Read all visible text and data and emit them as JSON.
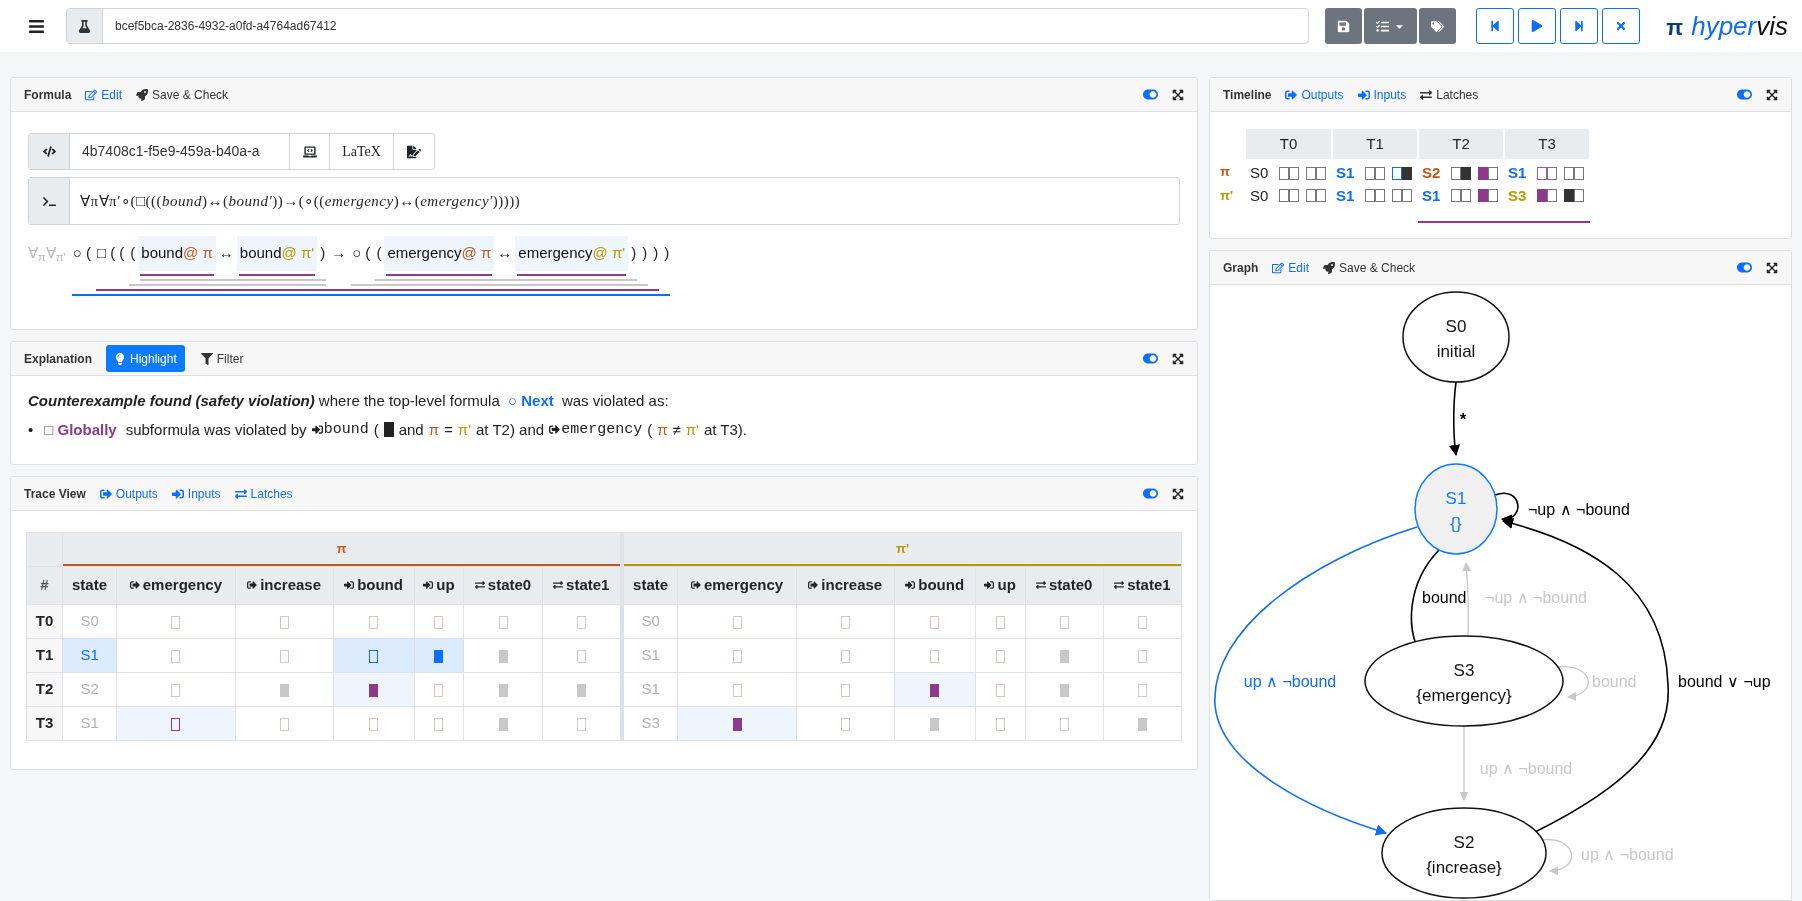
{
  "toolbar": {
    "session_id": "bcef5bca-2836-4932-a0fd-a4764ad67412",
    "file_buttons": [
      {
        "kind": "save"
      },
      {
        "kind": "checklist_menu"
      },
      {
        "kind": "tags"
      }
    ],
    "playback_buttons": [
      {
        "kind": "step_back"
      },
      {
        "kind": "play"
      },
      {
        "kind": "step_forward"
      },
      {
        "kind": "stop"
      }
    ],
    "logo": {
      "glyph": "π",
      "word_parts": [
        "hyper",
        "vis"
      ]
    }
  },
  "formula_panel": {
    "title": "Formula",
    "toggle_on": true,
    "actions": [
      {
        "kind": "edit",
        "label": "Edit"
      },
      {
        "kind": "run",
        "label": "Save & Check"
      }
    ],
    "formula_id": "4b7408c1-f5e9-459a-b40a-a",
    "id_buttons": [
      {
        "kind": "laptop"
      },
      {
        "kind": "latex",
        "label": "LaTeX"
      },
      {
        "kind": "sign"
      }
    ],
    "source": "∀π∀π′∘(□(((*bound*)↔(*bound′*))→(∘((*emergency*)↔(*emergency′*)))))",
    "quantifiers": "∀$_{π}$∀$_{π'}$",
    "tree": {
      "kind": "group",
      "color": "#0d6efd",
      "children": [
        {
          "kind": "text",
          "text": "○ ("
        },
        {
          "kind": "group",
          "color": "#8e3a8c",
          "children": [
            {
              "kind": "text",
              "text": "□ ( ("
            },
            {
              "kind": "group",
              "color": "#c8c8c8",
              "children": [
                {
                  "kind": "text",
                  "text": "("
                },
                {
                  "kind": "group",
                  "color": "#c8c8c8",
                  "children": [
                    {
                      "kind": "group",
                      "color": "#8e3a8c",
                      "children": [
                        {
                          "kind": "atom",
                          "name": "bound",
                          "marker": "@",
                          "trace": "π",
                          "color": "#c05a1a",
                          "highlighted": true
                        }
                      ]
                    },
                    {
                      "kind": "text",
                      "text": "↔"
                    },
                    {
                      "kind": "group",
                      "color": "#8e3a8c",
                      "children": [
                        {
                          "kind": "atom",
                          "name": "bound",
                          "marker": "@",
                          "trace": "π'",
                          "color": "#b89a00",
                          "highlighted": true
                        }
                      ]
                    },
                    {
                      "kind": "text",
                      "text": ")"
                    }
                  ]
                }
              ]
            },
            {
              "kind": "text",
              "text": "→"
            },
            {
              "kind": "group",
              "color": "#c8c8c8",
              "children": [
                {
                  "kind": "text",
                  "text": "○ ("
                },
                {
                  "kind": "group",
                  "color": "#c8c8c8",
                  "children": [
                    {
                      "kind": "text",
                      "text": "("
                    },
                    {
                      "kind": "group",
                      "color": "#8e3a8c",
                      "children": [
                        {
                          "kind": "atom",
                          "name": "emergency",
                          "marker": "@",
                          "trace": "π",
                          "color": "#c05a1a",
                          "highlighted": true
                        }
                      ]
                    },
                    {
                      "kind": "text",
                      "text": "↔"
                    },
                    {
                      "kind": "group",
                      "color": "#8e3a8c",
                      "children": [
                        {
                          "kind": "atom",
                          "name": "emergency",
                          "marker": "@",
                          "trace": "π'",
                          "color": "#b89a00",
                          "highlighted": true
                        }
                      ]
                    },
                    {
                      "kind": "text",
                      "text": ")"
                    }
                  ]
                },
                {
                  "kind": "text",
                  "text": ")"
                }
              ]
            },
            {
              "kind": "text",
              "text": ")"
            }
          ]
        },
        {
          "kind": "text",
          "text": ")"
        }
      ]
    }
  },
  "explanation_panel": {
    "title": "Explanation",
    "toggle_on": true,
    "tabs": [
      {
        "kind": "highlight",
        "label": "Highlight",
        "selected": true
      },
      {
        "kind": "filter",
        "label": "Filter",
        "selected": false
      }
    ],
    "summary": {
      "lead": "Counterexample found (safety violation)",
      "middle": " where the top-level formula ",
      "operator": {
        "symbol": "○",
        "name": "Next",
        "color": "#0d6efd"
      },
      "tail": " was violated as:"
    },
    "bullets": [
      {
        "marker": "•",
        "segments": [
          {
            "kind": "operator",
            "symbol": "□",
            "name": "Globally",
            "color": "#8e3a8c"
          },
          {
            "kind": "text",
            "text": "subformula was violated by"
          },
          {
            "kind": "input_signal",
            "name": "bound"
          },
          {
            "kind": "text",
            "text": "("
          },
          {
            "kind": "value",
            "value": true,
            "color": "#222222"
          },
          {
            "kind": "text",
            "text": "and"
          },
          {
            "kind": "trace",
            "text": "π",
            "color": "#c05a1a"
          },
          {
            "kind": "text",
            "text": "="
          },
          {
            "kind": "trace",
            "text": "π'",
            "color": "#b89a00"
          },
          {
            "kind": "text",
            "text": "at T2) and"
          },
          {
            "kind": "output_signal",
            "name": "emergency"
          },
          {
            "kind": "text",
            "text": "("
          },
          {
            "kind": "trace",
            "text": "π",
            "color": "#c05a1a"
          },
          {
            "kind": "text",
            "text": "≠"
          },
          {
            "kind": "trace",
            "text": "π'",
            "color": "#b89a00"
          },
          {
            "kind": "text",
            "text": "at T3)."
          }
        ]
      }
    ]
  },
  "trace_panel": {
    "title": "Trace View",
    "toggle_on": true,
    "tabs": [
      {
        "kind": "output",
        "label": "Outputs",
        "selected": true
      },
      {
        "kind": "input",
        "label": "Inputs",
        "selected": true
      },
      {
        "kind": "latch",
        "label": "Latches",
        "selected": true
      }
    ],
    "index_header": "#",
    "traces": [
      {
        "name": "π",
        "color": "#c05a1a",
        "columns": [
          {
            "kind": "state",
            "label": "state"
          },
          {
            "kind": "output",
            "label": "emergency"
          },
          {
            "kind": "output",
            "label": "increase"
          },
          {
            "kind": "input",
            "label": "bound"
          },
          {
            "kind": "input",
            "label": "up"
          },
          {
            "kind": "latch",
            "label": "state0"
          },
          {
            "kind": "latch",
            "label": "state1"
          }
        ]
      },
      {
        "name": "π'",
        "color": "#b89a00",
        "columns": [
          {
            "kind": "state",
            "label": "state"
          },
          {
            "kind": "output",
            "label": "emergency"
          },
          {
            "kind": "output",
            "label": "increase"
          },
          {
            "kind": "input",
            "label": "bound"
          },
          {
            "kind": "input",
            "label": "up"
          },
          {
            "kind": "latch",
            "label": "state0"
          },
          {
            "kind": "latch",
            "label": "state1"
          }
        ]
      }
    ],
    "rows": [
      {
        "label": "T0",
        "traces": [
          {
            "state": {
              "text": "S0",
              "color": "#b0b0b0",
              "current": false
            },
            "cells": [
              {
                "value": false,
                "color": "#dcc4bd",
                "current": false,
                "related": false
              },
              {
                "value": false,
                "color": "#dcc4bd",
                "current": false,
                "related": false
              },
              {
                "value": false,
                "color": "#dcc4bd",
                "current": false,
                "related": false
              },
              {
                "value": false,
                "color": "#dcc4bd",
                "current": false,
                "related": false
              },
              {
                "value": false,
                "color": "#cccccc",
                "current": false,
                "related": false
              },
              {
                "value": false,
                "color": "#cccccc",
                "current": false,
                "related": false
              }
            ]
          },
          {
            "state": {
              "text": "S0",
              "color": "#b0b0b0",
              "current": false
            },
            "cells": [
              {
                "value": false,
                "color": "#dcc4bd",
                "current": false,
                "related": false
              },
              {
                "value": false,
                "color": "#dcc4bd",
                "current": false,
                "related": false
              },
              {
                "value": false,
                "color": "#dcc4bd",
                "current": false,
                "related": false
              },
              {
                "value": false,
                "color": "#dcc4bd",
                "current": false,
                "related": false
              },
              {
                "value": false,
                "color": "#cccccc",
                "current": false,
                "related": false
              },
              {
                "value": false,
                "color": "#cccccc",
                "current": false,
                "related": false
              }
            ]
          }
        ]
      },
      {
        "label": "T1",
        "traces": [
          {
            "state": {
              "text": "S1",
              "color": "#0d6efd",
              "current": true
            },
            "cells": [
              {
                "value": false,
                "color": "#dcc4bd",
                "current": false,
                "related": false
              },
              {
                "value": false,
                "color": "#dcc4bd",
                "current": false,
                "related": false
              },
              {
                "value": false,
                "color": "#0d6efd",
                "current": true,
                "related": false
              },
              {
                "value": true,
                "color": "#0d6efd",
                "current": true,
                "related": false
              },
              {
                "value": true,
                "color": "#c8c8c8",
                "current": false,
                "related": false
              },
              {
                "value": false,
                "color": "#cccccc",
                "current": false,
                "related": false
              }
            ]
          },
          {
            "state": {
              "text": "S1",
              "color": "#b0b0b0",
              "current": false
            },
            "cells": [
              {
                "value": false,
                "color": "#dcc4bd",
                "current": false,
                "related": false
              },
              {
                "value": false,
                "color": "#dcc4bd",
                "current": false,
                "related": false
              },
              {
                "value": false,
                "color": "#dcc4bd",
                "current": false,
                "related": false
              },
              {
                "value": false,
                "color": "#dcc4bd",
                "current": false,
                "related": false
              },
              {
                "value": true,
                "color": "#c8c8c8",
                "current": false,
                "related": false
              },
              {
                "value": false,
                "color": "#cccccc",
                "current": false,
                "related": false
              }
            ]
          }
        ]
      },
      {
        "label": "T2",
        "traces": [
          {
            "state": {
              "text": "S2",
              "color": "#b0b0b0",
              "current": false
            },
            "cells": [
              {
                "value": false,
                "color": "#dcc4bd",
                "current": false,
                "related": false
              },
              {
                "value": true,
                "color": "#c8c8c8",
                "current": false,
                "related": false
              },
              {
                "value": true,
                "color": "#8e3a8c",
                "current": false,
                "related": true
              },
              {
                "value": false,
                "color": "#dcc4bd",
                "current": false,
                "related": false
              },
              {
                "value": true,
                "color": "#c8c8c8",
                "current": false,
                "related": false
              },
              {
                "value": true,
                "color": "#c8c8c8",
                "current": false,
                "related": false
              }
            ]
          },
          {
            "state": {
              "text": "S1",
              "color": "#b0b0b0",
              "current": false
            },
            "cells": [
              {
                "value": false,
                "color": "#dcc4bd",
                "current": false,
                "related": false
              },
              {
                "value": false,
                "color": "#dcc4bd",
                "current": false,
                "related": false
              },
              {
                "value": true,
                "color": "#8e3a8c",
                "current": false,
                "related": true
              },
              {
                "value": false,
                "color": "#dcc4bd",
                "current": false,
                "related": false
              },
              {
                "value": true,
                "color": "#c8c8c8",
                "current": false,
                "related": false
              },
              {
                "value": false,
                "color": "#cccccc",
                "current": false,
                "related": false
              }
            ]
          }
        ]
      },
      {
        "label": "T3",
        "traces": [
          {
            "state": {
              "text": "S1",
              "color": "#b0b0b0",
              "current": false
            },
            "cells": [
              {
                "value": false,
                "color": "#8e3a8c",
                "current": false,
                "related": true
              },
              {
                "value": false,
                "color": "#dcc4bd",
                "current": false,
                "related": false
              },
              {
                "value": false,
                "color": "#dcc4bd",
                "current": false,
                "related": false
              },
              {
                "value": false,
                "color": "#dcc4bd",
                "current": false,
                "related": false
              },
              {
                "value": true,
                "color": "#c8c8c8",
                "current": false,
                "related": false
              },
              {
                "value": false,
                "color": "#cccccc",
                "current": false,
                "related": false
              }
            ]
          },
          {
            "state": {
              "text": "S3",
              "color": "#b0b0b0",
              "current": false
            },
            "cells": [
              {
                "value": true,
                "color": "#8e3a8c",
                "current": false,
                "related": true
              },
              {
                "value": false,
                "color": "#dcc4bd",
                "current": false,
                "related": false
              },
              {
                "value": true,
                "color": "#c8c8c8",
                "current": false,
                "related": false
              },
              {
                "value": false,
                "color": "#dcc4bd",
                "current": false,
                "related": false
              },
              {
                "value": false,
                "color": "#cccccc",
                "current": false,
                "related": false
              },
              {
                "value": true,
                "color": "#c8c8c8",
                "current": false,
                "related": false
              }
            ]
          }
        ]
      }
    ]
  },
  "timeline_panel": {
    "title": "Timeline",
    "toggle_on": true,
    "tabs": [
      {
        "kind": "output",
        "label": "Outputs",
        "selected": true
      },
      {
        "kind": "input",
        "label": "Inputs",
        "selected": true
      },
      {
        "kind": "latch",
        "label": "Latches",
        "selected": false
      }
    ],
    "traces": [
      {
        "name": "π",
        "color": "#c05a1a"
      },
      {
        "name": "π'",
        "color": "#b89a00"
      }
    ],
    "steps": [
      {
        "label": "T0",
        "violated": false,
        "traces": [
          {
            "state": "S0",
            "color": "#212529",
            "groups": [
              [
                {
                  "value": false,
                  "color": "#777777"
                },
                {
                  "value": false,
                  "color": "#777777"
                }
              ],
              [
                {
                  "value": false,
                  "color": "#777777"
                },
                {
                  "value": false,
                  "color": "#777777"
                }
              ]
            ]
          },
          {
            "state": "S0",
            "color": "#212529",
            "groups": [
              [
                {
                  "value": false,
                  "color": "#777777"
                },
                {
                  "value": false,
                  "color": "#777777"
                }
              ],
              [
                {
                  "value": false,
                  "color": "#777777"
                },
                {
                  "value": false,
                  "color": "#777777"
                }
              ]
            ]
          }
        ]
      },
      {
        "label": "T1",
        "violated": false,
        "traces": [
          {
            "state": "S1",
            "color": "#0d6efd",
            "groups": [
              [
                {
                  "value": false,
                  "color": "#777777"
                },
                {
                  "value": false,
                  "color": "#777777"
                }
              ],
              [
                {
                  "value": false,
                  "color": "#0d6efd"
                },
                {
                  "value": true,
                  "color": "#333333"
                }
              ]
            ]
          },
          {
            "state": "S1",
            "color": "#0d6efd",
            "groups": [
              [
                {
                  "value": false,
                  "color": "#777777"
                },
                {
                  "value": false,
                  "color": "#777777"
                }
              ],
              [
                {
                  "value": false,
                  "color": "#777777"
                },
                {
                  "value": false,
                  "color": "#777777"
                }
              ]
            ]
          }
        ]
      },
      {
        "label": "T2",
        "violated": true,
        "traces": [
          {
            "state": "S2",
            "color": "#c05a1a",
            "groups": [
              [
                {
                  "value": false,
                  "color": "#777777"
                },
                {
                  "value": true,
                  "color": "#333333"
                }
              ],
              [
                {
                  "value": true,
                  "color": "#8e3a8c"
                },
                {
                  "value": false,
                  "color": "#777777"
                }
              ]
            ]
          },
          {
            "state": "S1",
            "color": "#0d6efd",
            "groups": [
              [
                {
                  "value": false,
                  "color": "#777777"
                },
                {
                  "value": false,
                  "color": "#777777"
                }
              ],
              [
                {
                  "value": true,
                  "color": "#8e3a8c"
                },
                {
                  "value": false,
                  "color": "#777777"
                }
              ]
            ]
          }
        ]
      },
      {
        "label": "T3",
        "violated": true,
        "traces": [
          {
            "state": "S1",
            "color": "#0d6efd",
            "groups": [
              [
                {
                  "value": false,
                  "color": "#a35aa8"
                },
                {
                  "value": false,
                  "color": "#777777"
                }
              ],
              [
                {
                  "value": false,
                  "color": "#777777"
                },
                {
                  "value": false,
                  "color": "#777777"
                }
              ]
            ]
          },
          {
            "state": "S3",
            "color": "#b89a00",
            "groups": [
              [
                {
                  "value": true,
                  "color": "#8e3a8c"
                },
                {
                  "value": false,
                  "color": "#777777"
                }
              ],
              [
                {
                  "value": true,
                  "color": "#333333"
                },
                {
                  "value": false,
                  "color": "#777777"
                }
              ]
            ]
          }
        ]
      }
    ]
  },
  "graph_panel": {
    "title": "Graph",
    "toggle_on": true,
    "actions": [
      {
        "kind": "edit",
        "label": "Edit"
      },
      {
        "kind": "run",
        "label": "Save & Check"
      }
    ],
    "nodes": [
      {
        "name": "S0",
        "label": "initial",
        "current": false
      },
      {
        "name": "S1",
        "label": "{}",
        "current": true
      },
      {
        "name": "S3",
        "label": "{emergency}",
        "current": false
      },
      {
        "name": "S2",
        "label": "{increase}",
        "current": false
      }
    ],
    "edges": [
      {
        "label": "*",
        "color": "#000000"
      },
      {
        "label": "¬up ∧ ¬bound",
        "color": "#000000"
      },
      {
        "label": "bound",
        "color": "#000000"
      },
      {
        "label": "¬up ∧ ¬bound",
        "color": "#c8c8c8"
      },
      {
        "label": "up ∧ ¬bound",
        "color": "#0d6efd"
      },
      {
        "label": "bound",
        "color": "#c8c8c8"
      },
      {
        "label": "bound ∨ ¬up",
        "color": "#000000"
      },
      {
        "label": "up ∧ ¬bound",
        "color": "#c8c8c8"
      },
      {
        "label": "up ∧ ¬bound",
        "color": "#c8c8c8"
      }
    ]
  }
}
